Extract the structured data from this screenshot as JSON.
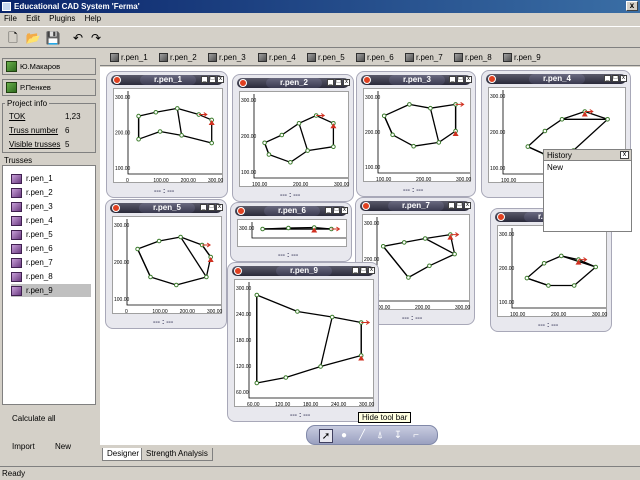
{
  "app": {
    "title": "Educational CAD System 'Ferma'",
    "close": "x"
  },
  "menu": {
    "file": "File",
    "edit": "Edit",
    "plugins": "Plugins",
    "help": "Help"
  },
  "toolbar": {
    "new": "🗋",
    "open": "📂",
    "save": "💾",
    "undo": "↶",
    "redo": "↷"
  },
  "tabs": [
    "r.pen_1",
    "r.pen_2",
    "r.pen_3",
    "r.pen_4",
    "r.pen_5",
    "r.pen_6",
    "r.pen_7",
    "r.pen_8",
    "r.pen_9"
  ],
  "users": [
    "Ю.Макаров",
    "Р.Пенкев"
  ],
  "project": {
    "header": "Project info",
    "tok_label": "TOK",
    "tok_value": "1,23",
    "truss_label": "Truss number",
    "truss_value": "6",
    "visible_label": "Visible trusses",
    "visible_value": "5"
  },
  "trusses": {
    "header": "Trusses",
    "items": [
      "r.pen_1",
      "r.pen_2",
      "r.pen_3",
      "r.pen_4",
      "r.pen_5",
      "r.pen_6",
      "r.pen_7",
      "r.pen_8",
      "r.pen_9"
    ],
    "selected": 8
  },
  "left_buttons": {
    "calc": "Calculate all",
    "import": "Import",
    "new": "New"
  },
  "windows": [
    {
      "title": "r.pen_1",
      "yt": [
        "300.00",
        "200.00",
        "100.00"
      ],
      "xt": [
        "0",
        "100.00",
        "200.00",
        "300.00"
      ]
    },
    {
      "title": "r.pen_2",
      "yt": [
        "300.00",
        "200.00",
        "100.00"
      ],
      "xt": [
        "100.00",
        "200.00",
        "300.00"
      ]
    },
    {
      "title": "r.pen_3",
      "yt": [
        "300.00",
        "200.00",
        "100.00"
      ],
      "xt": [
        "100.00",
        "200.00",
        "300.00"
      ]
    },
    {
      "title": "r.pen_4",
      "yt": [
        "300.00",
        "200.00",
        "100.00"
      ],
      "xt": [
        "100.00"
      ]
    },
    {
      "title": "r.pen_5",
      "yt": [
        "300.00",
        "200.00",
        "100.00"
      ],
      "xt": [
        "0",
        "100.00",
        "200.00",
        "300.00"
      ]
    },
    {
      "title": "r.pen_6",
      "yt": [
        "300.00"
      ],
      "xt": []
    },
    {
      "title": "r.pen_7",
      "yt": [
        "300.00",
        "200.00",
        "100.00"
      ],
      "xt": [
        "100.00",
        "200.00",
        "300.00"
      ]
    },
    {
      "title": "r.pen_8",
      "yt": [
        "300.00",
        "200.00",
        "100.00"
      ],
      "xt": [
        "100.00",
        "200.00",
        "300.00"
      ]
    },
    {
      "title": "r.pen_9",
      "yt": [
        "300.00",
        "240.00",
        "180.00",
        "120.00",
        "60.00"
      ],
      "xt": [
        "60.00",
        "120.00",
        "180.00",
        "240.00",
        "300.00"
      ]
    }
  ],
  "window_footer": "--- : ---",
  "history": {
    "title": "History",
    "items": [
      "New"
    ],
    "close": "x"
  },
  "drawbar": {
    "tooltip": "Hide tool bar"
  },
  "bottom_tabs": [
    "Designer",
    "Strength Analysis"
  ],
  "status": "Ready"
}
